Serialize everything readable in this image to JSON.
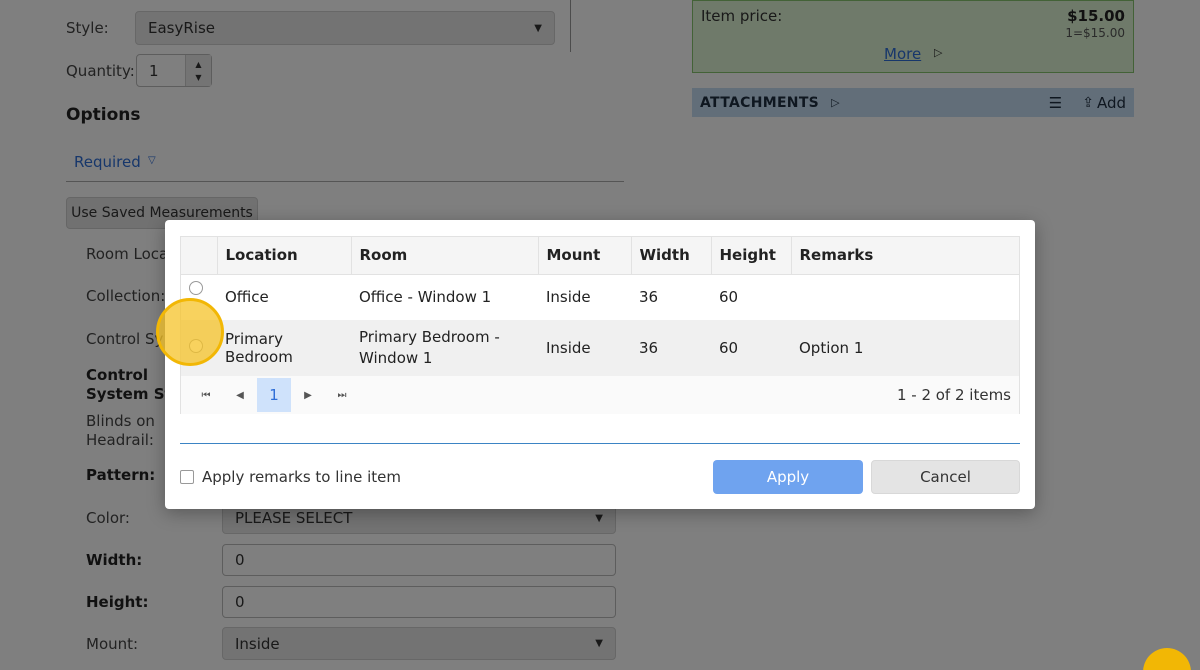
{
  "form": {
    "style_label": "Style:",
    "style_value": "EasyRise",
    "quantity_label": "Quantity:",
    "quantity_value": "1",
    "options_heading": "Options",
    "required_link": "Required",
    "saved_measurements_button": "Use Saved Measurements",
    "room_location_label": "Room Locat",
    "collection_label": "Collection:",
    "control_system_label": "Control Sy",
    "control_system_style_label_1": "Control",
    "control_system_style_label_2": "System Sty",
    "blinds_on_headrail_label_1": "Blinds on",
    "blinds_on_headrail_label_2": "Headrail:",
    "pattern_label": "Pattern:",
    "color_label": "Color:",
    "color_value": "PLEASE SELECT",
    "width_label": "Width:",
    "width_value": "0",
    "height_label": "Height:",
    "height_value": "0",
    "mount_label": "Mount:",
    "mount_value": "Inside"
  },
  "price_panel": {
    "item_price_label": "Item price:",
    "item_price_value": "$15.00",
    "unit_price": "1=$15.00",
    "more_link": "More"
  },
  "attachments": {
    "title": "ATTACHMENTS",
    "add_label": "Add"
  },
  "modal": {
    "columns": [
      "Location",
      "Room",
      "Mount",
      "Width",
      "Height",
      "Remarks"
    ],
    "rows": [
      {
        "location": "Office",
        "room": "Office - Window 1",
        "mount": "Inside",
        "width": "36",
        "height": "60",
        "remarks": ""
      },
      {
        "location": "Primary Bedroom",
        "room": "Primary Bedroom - Window 1",
        "mount": "Inside",
        "width": "36",
        "height": "60",
        "remarks": "Option 1"
      }
    ],
    "pager": {
      "current_page": "1",
      "info": "1 - 2 of 2 items"
    },
    "apply_remarks_label": "Apply remarks to line item",
    "apply_button": "Apply",
    "cancel_button": "Cancel"
  },
  "colors": {
    "accent_blue": "#3b84c4",
    "apply_button": "#6fa3ef",
    "highlight": "#f2b705",
    "price_box": "#dff5d4",
    "attachments_bar": "#c5dcf3"
  }
}
